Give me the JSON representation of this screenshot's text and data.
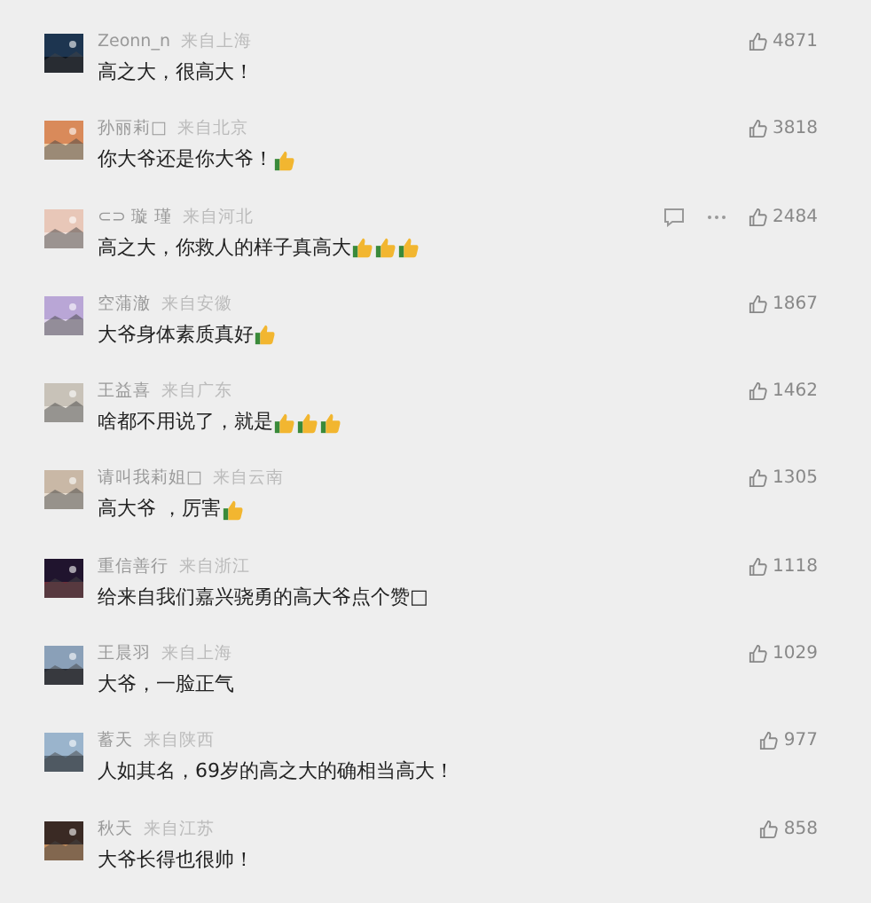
{
  "comments": [
    {
      "name": "Zeonn_n",
      "location": "来自上海",
      "text": "高之大，很高大！",
      "likes": "4871",
      "hover": false
    },
    {
      "name": "孙丽莉□",
      "location": "来自北京",
      "text": "你大爷还是你大爷！",
      "emojis": [
        {
          "kind": "thumbs-up"
        }
      ],
      "likes": "3818",
      "hover": false
    },
    {
      "name": "⊂⊃ 璇 瑾",
      "location": "来自河北",
      "text": "高之大，你救人的样子真高大",
      "emojis": [
        {
          "kind": "thumbs-up"
        },
        {
          "kind": "thumbs-up"
        },
        {
          "kind": "thumbs-up"
        }
      ],
      "likes": "2484",
      "hover": true
    },
    {
      "name": "空蒲澈",
      "location": "来自安徽",
      "text": "大爷身体素质真好",
      "emojis": [
        {
          "kind": "thumbs-up"
        }
      ],
      "likes": "1867",
      "hover": false
    },
    {
      "name": "王益喜",
      "location": "来自广东",
      "text": "啥都不用说了，就是",
      "emojis": [
        {
          "kind": "thumbs-up"
        },
        {
          "kind": "thumbs-up"
        },
        {
          "kind": "thumbs-up"
        }
      ],
      "likes": "1462",
      "hover": false
    },
    {
      "name": "请叫我莉姐□",
      "location": "来自云南",
      "text": "高大爷 ，厉害",
      "emojis": [
        {
          "kind": "thumbs-up"
        }
      ],
      "likes": "1305",
      "hover": false
    },
    {
      "name": "重信善行",
      "location": "来自浙江",
      "text": "给来自我们嘉兴骁勇的高大爷点个赞□",
      "likes": "1118",
      "hover": false
    },
    {
      "name": "王晨羽",
      "location": "来自上海",
      "text": "大爷，一脸正气",
      "likes": "1029",
      "hover": false
    },
    {
      "name": "蓄天",
      "location": "来自陕西",
      "text": "人如其名，69岁的高之大的确相当高大！",
      "likes": "977",
      "hover": false
    },
    {
      "name": "秋天",
      "location": "来自江苏",
      "text": "大爷长得也很帅！",
      "likes": "858",
      "hover": false
    }
  ]
}
